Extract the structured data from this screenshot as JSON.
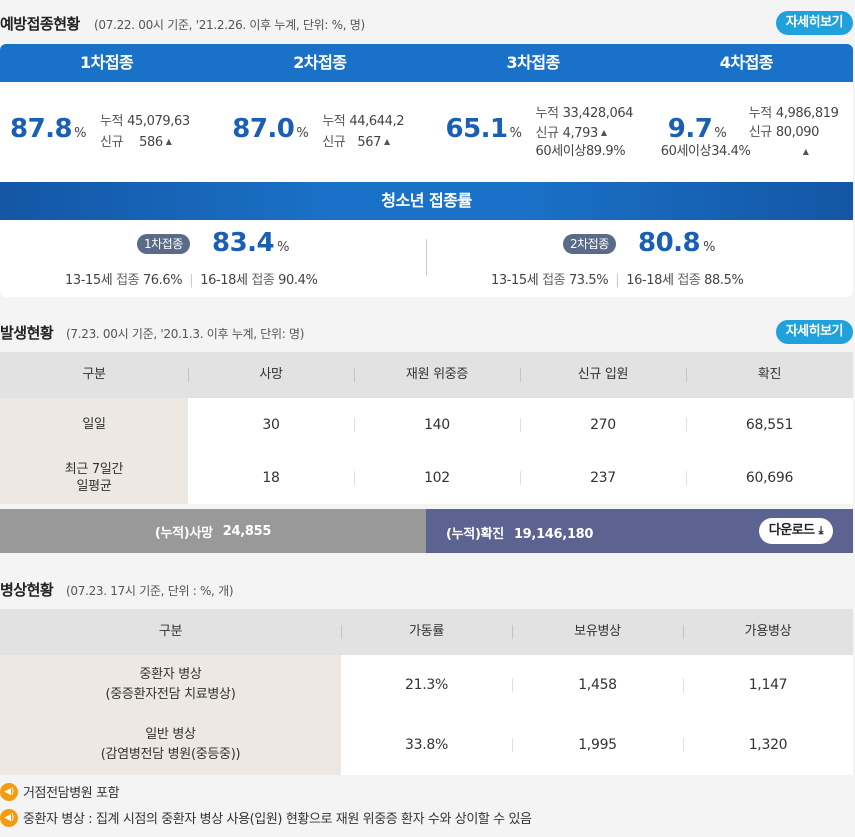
{
  "vaccination": {
    "title": "예방접종현황",
    "note": "(07.22. 00시 기준, '21.2.26. 이후 누계, 단위: %, 명)",
    "more_label": "자세히보기",
    "doses": [
      {
        "label": "1차접종",
        "rate": "87.8",
        "unit": "%",
        "cumulative_label": "누적",
        "cumulative": "45,079,63",
        "new_label": "신규",
        "new": "586"
      },
      {
        "label": "2차접종",
        "rate": "87.0",
        "unit": "%",
        "cumulative_label": "누적",
        "cumulative": "44,644,2",
        "new_label": "신규",
        "new": "567"
      },
      {
        "label": "3차접종",
        "rate": "65.1",
        "unit": "%",
        "cumulative_label": "누적",
        "cumulative": "33,428,064",
        "new_label": "신규",
        "new": "4,793",
        "over60_label": "60세이상",
        "over60": "89.9%"
      },
      {
        "label": "4차접종",
        "rate": "9.7",
        "unit": "%",
        "cumulative_label": "누적",
        "cumulative": "4,986,819",
        "new_label": "신규",
        "new": "80,090",
        "over60_label": "60세이상",
        "over60": "34.4%"
      }
    ],
    "teen": {
      "title": "청소년 접종률",
      "first": {
        "pill": "1차접종",
        "rate": "83.4",
        "unit": "%",
        "age1": "13-15세",
        "age2": "16-18세",
        "word": "접종",
        "rate1": "76.6%",
        "rate2": "90.4%"
      },
      "second": {
        "pill": "2차접종",
        "rate": "80.8",
        "unit": "%",
        "age1": "13-15세",
        "age2": "16-18세",
        "word": "접종",
        "rate1": "73.5%",
        "rate2": "88.5%"
      }
    }
  },
  "outbreak": {
    "title": "발생현황",
    "note": "(7.23. 00시 기준, '20.1.3. 이후 누계, 단위: 명)",
    "more_label": "자세히보기",
    "headers": [
      "구분",
      "사망",
      "재원 위중증",
      "신규 입원",
      "확진"
    ],
    "rows": [
      {
        "label": "일일",
        "values": [
          "30",
          "140",
          "270",
          "68,551"
        ]
      },
      {
        "label": "최근 7일간\n일평균",
        "values": [
          "18",
          "102",
          "237",
          "60,696"
        ]
      }
    ],
    "cum_death_label": "(누적)사망",
    "cum_death": "24,855",
    "cum_confirmed_label": "(누적)확진",
    "cum_confirmed": "19,146,180",
    "download_label": "다운로드"
  },
  "beds": {
    "title": "병상현황",
    "note": "(07.23. 17시 기준, 단위 : %, 개)",
    "headers": [
      "구분",
      "가동률",
      "보유병상",
      "가용병상"
    ],
    "rows": [
      {
        "label": "중환자 병상\n(중증환자전담 치료병상)",
        "values": [
          "21.3%",
          "1,458",
          "1,147"
        ]
      },
      {
        "label": "일반 병상\n(감염병전담 병원(중등중))",
        "values": [
          "33.8%",
          "1,995",
          "1,320"
        ]
      }
    ]
  },
  "notes": [
    "거점전담병원 포함",
    "중환자 병상 : 집계 시점의 중환자 병상 사용(입원) 현황으로 재원 위중증 환자 수와 상이할 수 있음"
  ],
  "icons": {
    "speaker": "speaker-icon",
    "download": "download-icon",
    "up": "up-triangle-icon"
  },
  "colors": {
    "primary": "#1a72c8",
    "accent": "#20a1dc",
    "value": "#1a5fb4",
    "cum_right": "#5d6391",
    "notice": "#f39c12"
  }
}
